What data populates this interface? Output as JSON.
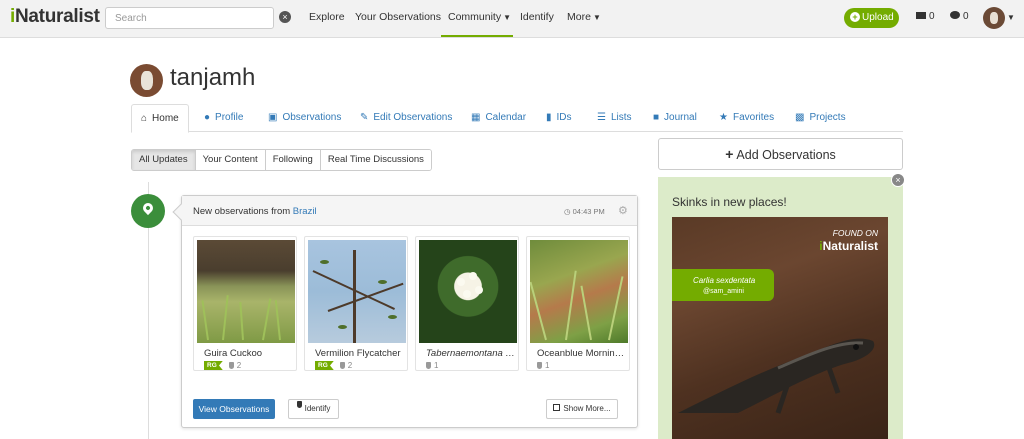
{
  "nav": {
    "logo_i": "i",
    "logo_rest": "Naturalist",
    "search_placeholder": "Search",
    "links": {
      "explore": "Explore",
      "your_observations": "Your Observations",
      "community": "Community",
      "identify": "Identify",
      "more": "More"
    },
    "upload_label": "Upload",
    "messages_count": "0",
    "notifications_count": "0",
    "accent_color": "#74ac00"
  },
  "profile": {
    "username": "tanjamh"
  },
  "tabs": {
    "home": "Home",
    "profile": "Profile",
    "observations": "Observations",
    "edit_observations": "Edit Observations",
    "calendar": "Calendar",
    "ids": "IDs",
    "lists": "Lists",
    "journal": "Journal",
    "favorites": "Favorites",
    "projects": "Projects"
  },
  "filters": {
    "all_updates": "All Updates",
    "your_content": "Your Content",
    "following": "Following",
    "real_time": "Real Time Discussions"
  },
  "feed": {
    "title_prefix": "New observations from",
    "place": "Brazil",
    "time": "04:43 PM",
    "observations": [
      {
        "name": "Guira Cuckoo",
        "rg": "RG",
        "ids": "2"
      },
      {
        "name": "Vermilion Flycatcher",
        "rg": "RG",
        "ids": "2"
      },
      {
        "name": "Tabernaemontana cat...",
        "ids": "1"
      },
      {
        "name": "Oceanblue Morning ...",
        "ids": "1"
      }
    ],
    "view_button": "View Observations",
    "identify_button": "Identify",
    "show_more_button": "Show More..."
  },
  "sidebar": {
    "add_observations": "Add Observations",
    "promo_title": "Skinks in new places!",
    "found_on": "FOUND ON",
    "brand_i": "i",
    "brand_rest": "Naturalist",
    "species": "Carlia sexdentata",
    "observer": "@sam_amini",
    "promo_bg": "#dcebc9"
  }
}
